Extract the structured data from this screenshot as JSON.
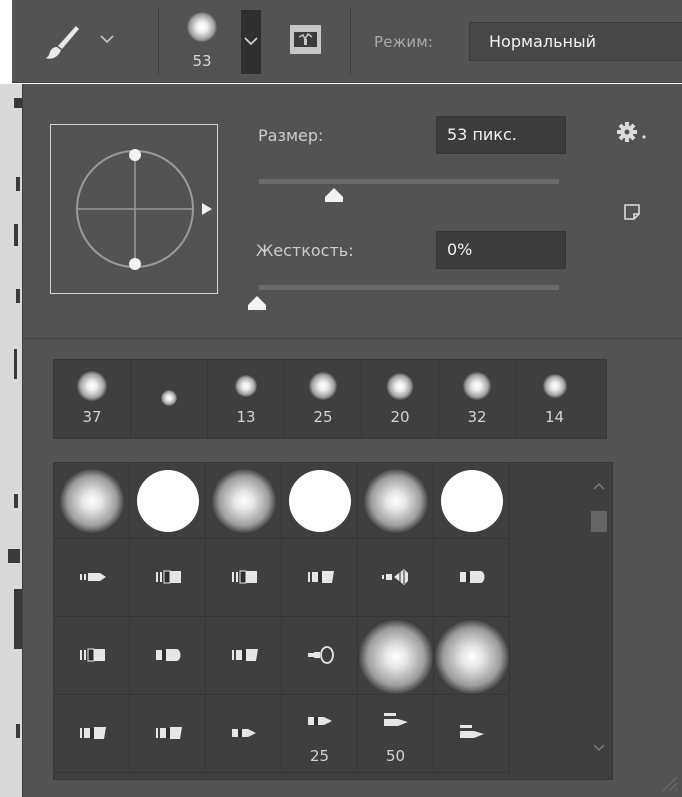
{
  "options_bar": {
    "tool_icon": "brush-icon",
    "tool_menu_icon": "chevron-down-icon",
    "brush_size": "53",
    "brush_menu_icon": "chevron-down-icon",
    "brush_panel_icon": "brush-settings-panel-icon",
    "mode_label": "Режим:",
    "mode_value": "Нормальный"
  },
  "brush_panel": {
    "angle_widget_icon": "brush-angle-roundness-icon",
    "size_label": "Размер:",
    "size_value": "53 пикс.",
    "size_slider_fraction": 0.25,
    "hardness_label": "Жесткость:",
    "hardness_value": "0%",
    "hardness_slider_fraction": 0.0,
    "settings_icon": "gear-icon",
    "new_preset_icon": "new-preset-icon",
    "recent_brushes": [
      {
        "size": "37",
        "kind": "soft"
      },
      {
        "size": "",
        "kind": "soft-small"
      },
      {
        "size": "13",
        "kind": "soft"
      },
      {
        "size": "25",
        "kind": "soft"
      },
      {
        "size": "20",
        "kind": "soft"
      },
      {
        "size": "32",
        "kind": "soft"
      },
      {
        "size": "14",
        "kind": "soft"
      }
    ],
    "preset_rows": [
      [
        {
          "kind": "soft-round",
          "label": ""
        },
        {
          "kind": "hard-round",
          "label": ""
        },
        {
          "kind": "soft-round",
          "label": ""
        },
        {
          "kind": "hard-round",
          "label": ""
        },
        {
          "kind": "soft-round",
          "label": ""
        },
        {
          "kind": "hard-round",
          "label": ""
        }
      ],
      [
        {
          "kind": "tip-round",
          "label": ""
        },
        {
          "kind": "tip-flat",
          "label": ""
        },
        {
          "kind": "tip-flat",
          "label": ""
        },
        {
          "kind": "tip-angled",
          "label": ""
        },
        {
          "kind": "tip-fan",
          "label": ""
        },
        {
          "kind": "tip-blunt",
          "label": ""
        }
      ],
      [
        {
          "kind": "tip-flat",
          "label": ""
        },
        {
          "kind": "tip-blunt",
          "label": ""
        },
        {
          "kind": "tip-angled",
          "label": ""
        },
        {
          "kind": "tip-sponge",
          "label": ""
        },
        {
          "kind": "soft-round-large",
          "label": ""
        },
        {
          "kind": "soft-round-large",
          "label": ""
        }
      ],
      [
        {
          "kind": "tip-angled",
          "label": ""
        },
        {
          "kind": "tip-angled",
          "label": ""
        },
        {
          "kind": "tip-pencil",
          "label": ""
        },
        {
          "kind": "tip-pencil",
          "label": "25"
        },
        {
          "kind": "tip-marker",
          "label": "50"
        },
        {
          "kind": "tip-marker",
          "label": ""
        }
      ]
    ],
    "scroll_up_icon": "chevron-up-icon",
    "scroll_down_icon": "chevron-down-icon",
    "resize_icon": "resize-grip-icon"
  }
}
